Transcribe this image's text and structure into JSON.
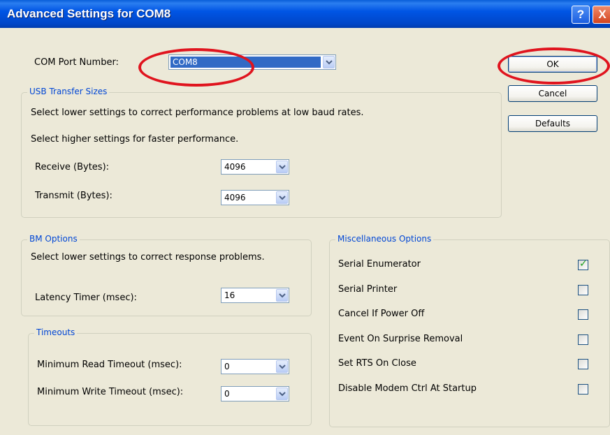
{
  "window": {
    "title": "Advanced Settings for COM8",
    "help_label": "?",
    "close_label": "X"
  },
  "com_port": {
    "label": "COM Port Number:",
    "value": "COM8"
  },
  "buttons": {
    "ok": "OK",
    "cancel": "Cancel",
    "defaults": "Defaults"
  },
  "usb_transfer": {
    "title": "USB Transfer Sizes",
    "line1": "Select lower settings to correct performance problems at low baud rates.",
    "line2": "Select higher settings for faster performance.",
    "receive_label": "Receive (Bytes):",
    "receive_value": "4096",
    "transmit_label": "Transmit (Bytes):",
    "transmit_value": "4096"
  },
  "bm_options": {
    "title": "BM Options",
    "line1": "Select lower settings to correct response problems.",
    "latency_label": "Latency Timer (msec):",
    "latency_value": "16"
  },
  "timeouts": {
    "title": "Timeouts",
    "read_label": "Minimum Read Timeout (msec):",
    "read_value": "0",
    "write_label": "Minimum Write Timeout (msec):",
    "write_value": "0"
  },
  "misc": {
    "title": "Miscellaneous Options",
    "items": [
      {
        "label": "Serial Enumerator",
        "checked": true
      },
      {
        "label": "Serial Printer",
        "checked": false
      },
      {
        "label": "Cancel If Power Off",
        "checked": false
      },
      {
        "label": "Event On Surprise Removal",
        "checked": false
      },
      {
        "label": "Set RTS On Close",
        "checked": false
      },
      {
        "label": "Disable Modem Ctrl At Startup",
        "checked": false
      }
    ]
  },
  "annotation_color": "#e0141e",
  "accent_blue": "#0046d5"
}
